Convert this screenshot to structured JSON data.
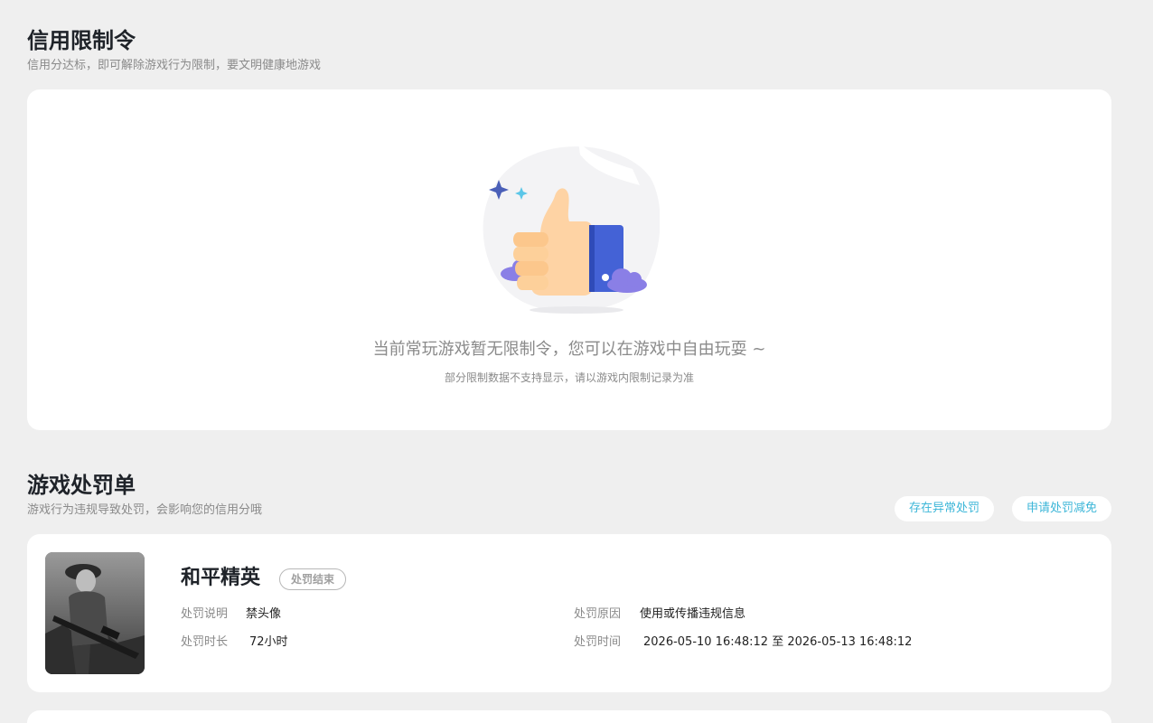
{
  "credit_section": {
    "title": "信用限制令",
    "subtitle": "信用分达标，即可解除游戏行为限制，要文明健康地游戏",
    "empty_main": "当前常玩游戏暂无限制令，您可以在游戏中自由玩耍 ~",
    "empty_sub": "部分限制数据不支持显示，请以游戏内限制记录为准",
    "illustration_icon": "thumbs-up-icon"
  },
  "penalty_section": {
    "title": "游戏处罚单",
    "subtitle": "游戏行为违规导致处罚，会影响您的信用分哦",
    "buttons": {
      "abnormal": "存在异常处罚",
      "reduce": "申请处罚减免"
    }
  },
  "penalty_card": {
    "game_name": "和平精英",
    "status": "处罚结束",
    "desc_label": "处罚说明",
    "desc_value": "禁头像",
    "duration_label": "处罚时长",
    "duration_value": "72小时",
    "reason_label": "处罚原因",
    "reason_value": "使用或传播违规信息",
    "time_label": "处罚时间",
    "time_value": "2026-05-10 16:48:12 至 2026-05-13 16:48:12"
  },
  "colors": {
    "background": "#efefef",
    "card": "#ffffff",
    "accent": "#3cb6d8",
    "title": "#1f2329",
    "muted": "#8a8a8a"
  }
}
